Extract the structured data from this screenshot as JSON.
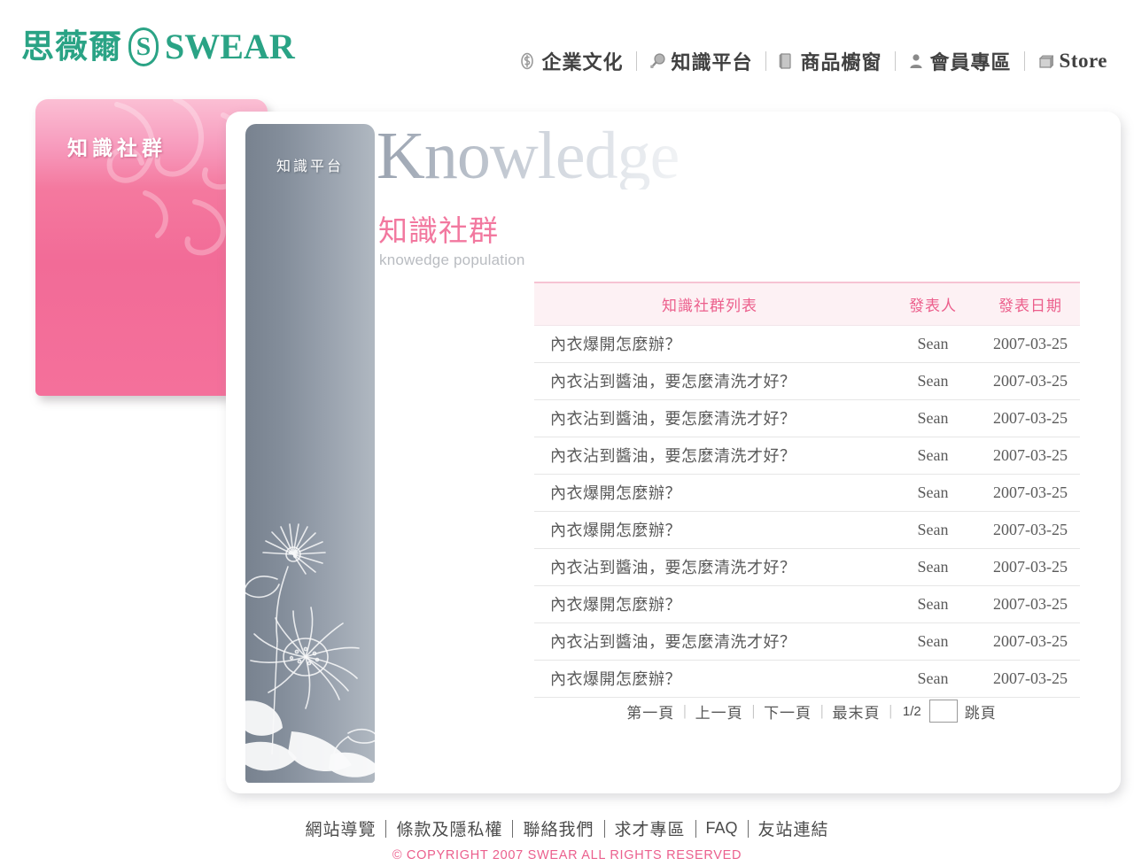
{
  "brand": {
    "logo_cn": "思薇爾",
    "logo_mark": "S",
    "logo_en": "SWEAR",
    "color": "#2aa385"
  },
  "topnav": {
    "items": [
      {
        "label": "企業文化",
        "icon": "dollar-scroll-icon",
        "latin": false
      },
      {
        "label": "知識平台",
        "icon": "magnifier-icon",
        "latin": false
      },
      {
        "label": "商品櫥窗",
        "icon": "book-icon",
        "latin": false
      },
      {
        "label": "會員專區",
        "icon": "person-icon",
        "latin": false
      },
      {
        "label": "Store",
        "icon": "shop-cube-icon",
        "latin": true
      }
    ]
  },
  "pink_panel": {
    "label": "知識社群",
    "color": "#f2679a"
  },
  "sidebar": {
    "label": "知識平台",
    "gradient_from": "#78828f",
    "gradient_to": "#b0b8c1"
  },
  "main": {
    "watermark": "Knowledge",
    "title_cn": "知識社群",
    "title_en": "knowedge population",
    "title_color": "#f2789f"
  },
  "table": {
    "headers": {
      "title": "知識社群列表",
      "author": "發表人",
      "date": "發表日期"
    },
    "rows": [
      {
        "title": "內衣爆開怎麼辦？",
        "author": "Sean",
        "date": "2007-03-25"
      },
      {
        "title": "內衣沾到醬油，要怎麼清洗才好？",
        "author": "Sean",
        "date": "2007-03-25"
      },
      {
        "title": "內衣沾到醬油，要怎麼清洗才好？",
        "author": "Sean",
        "date": "2007-03-25"
      },
      {
        "title": "內衣沾到醬油，要怎麼清洗才好？",
        "author": "Sean",
        "date": "2007-03-25"
      },
      {
        "title": "內衣爆開怎麼辦？",
        "author": "Sean",
        "date": "2007-03-25"
      },
      {
        "title": "內衣爆開怎麼辦？",
        "author": "Sean",
        "date": "2007-03-25"
      },
      {
        "title": "內衣沾到醬油，要怎麼清洗才好？",
        "author": "Sean",
        "date": "2007-03-25"
      },
      {
        "title": "內衣爆開怎麼辦？",
        "author": "Sean",
        "date": "2007-03-25"
      },
      {
        "title": "內衣沾到醬油，要怎麼清洗才好？",
        "author": "Sean",
        "date": "2007-03-25"
      },
      {
        "title": "內衣爆開怎麼辦？",
        "author": "Sean",
        "date": "2007-03-25"
      }
    ]
  },
  "pager": {
    "first": "第一頁",
    "prev": "上一頁",
    "next": "下一頁",
    "last": "最末頁",
    "separator": "|",
    "count": "1/2",
    "jump_value": "",
    "jump_placeholder": "",
    "jump_label": "跳頁"
  },
  "footer": {
    "links": [
      {
        "label": "網站導覽",
        "latin": false
      },
      {
        "label": "條款及隱私權",
        "latin": false
      },
      {
        "label": "聯絡我們",
        "latin": false
      },
      {
        "label": "求才專區",
        "latin": false
      },
      {
        "label": "FAQ",
        "latin": true
      },
      {
        "label": "友站連結",
        "latin": false
      }
    ],
    "copyright": "© COPYRIGHT 2007 SWEAR ALL RIGHTS RESERVED",
    "copyright_color": "#eb5f8d"
  }
}
